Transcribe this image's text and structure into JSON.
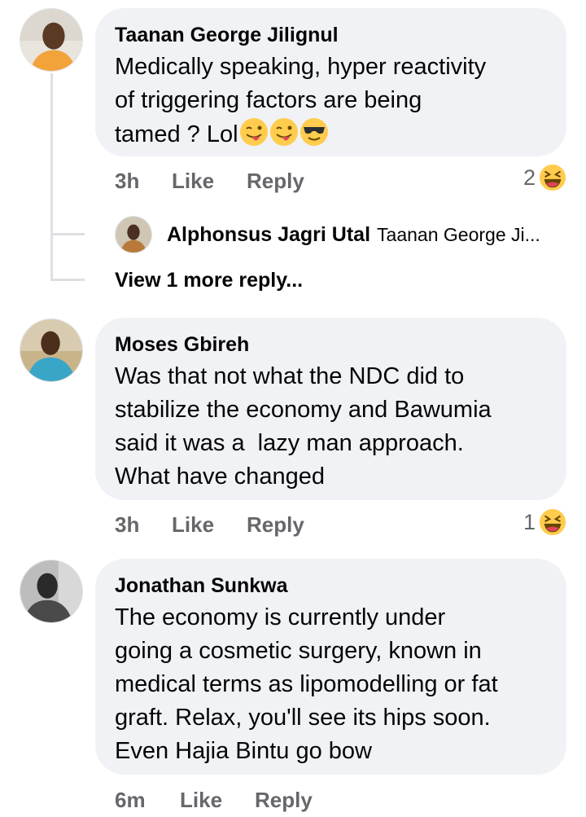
{
  "comments": [
    {
      "author": "Taanan George Jilignul",
      "text_lines": [
        "Medically speaking, hyper reactivity",
        "of triggering factors are being",
        "tamed ? Lol"
      ],
      "trailing_emojis": [
        "winking-tongue-face-icon",
        "winking-tongue-face-icon",
        "sunglasses-face-icon"
      ],
      "time": "3h",
      "like_label": "Like",
      "reply_label": "Reply",
      "reaction_count": "2",
      "reaction_icon": "laughing-face-icon"
    },
    {
      "author": "Moses Gbireh",
      "text_lines": [
        "Was that not what the NDC did to",
        "stabilize the economy and Bawumia",
        "said it was a  lazy man approach.",
        "What have changed"
      ],
      "time": "3h",
      "like_label": "Like",
      "reply_label": "Reply",
      "reaction_count": "1",
      "reaction_icon": "laughing-face-icon"
    },
    {
      "author": "Jonathan Sunkwa",
      "text_lines": [
        "The economy is currently under",
        "going a cosmetic surgery, known in",
        "medical terms as lipomodelling or fat",
        "graft. Relax, you'll see its hips soon.",
        "Even Hajia Bintu go bow"
      ],
      "time": "6m",
      "like_label": "Like",
      "reply_label": "Reply"
    }
  ],
  "reply_preview": {
    "author": "Alphonsus Jagri Utal",
    "snippet": "Taanan George Ji..."
  },
  "view_more_label": "View 1 more reply...",
  "colors": {
    "bubble": "#f0f2f5",
    "meta_text": "#65676b",
    "primary_text": "#050505",
    "emoji_yellow": "#ffcc4d"
  }
}
